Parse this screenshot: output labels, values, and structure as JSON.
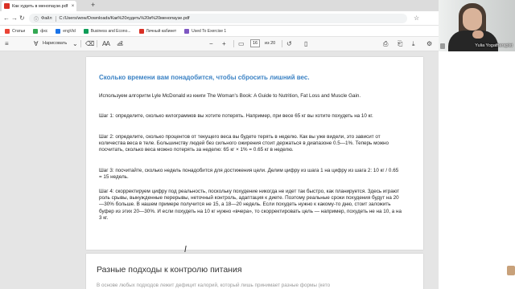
{
  "browser": {
    "tab": {
      "title": "Как худеть в менопаузе.pdf",
      "close": "×"
    },
    "new_tab": "+",
    "address": {
      "scheme_label": "Файл",
      "url": "C:/Users/wow/Downloads/Как%20худеть%20в%20менопаузе.pdf"
    },
    "bookmarks": [
      {
        "label": "Статьи",
        "color": "#ea4335"
      },
      {
        "label": "фхс",
        "color": "#34a853"
      },
      {
        "label": "engVid",
        "color": "#1a73e8"
      },
      {
        "label": "Business and Econo...",
        "color": "#0f9d58"
      },
      {
        "label": "Личный кабинет",
        "color": "#d93025"
      },
      {
        "label": "Used To Exercise 1",
        "color": "#7e57c2"
      }
    ]
  },
  "pdf_toolbar": {
    "draw_label": "Нарисовать",
    "page_current": "16",
    "page_total": "из 20",
    "zoom_out": "−",
    "zoom_in": "+"
  },
  "pdf": {
    "page1": {
      "heading": "Сколько времени вам понадобится, чтобы сбросить лишний вес.",
      "paragraphs": [
        "Используем алгоритм Lyle McDonald из книги The Woman's Book: A Guide to Nutrition, Fat Loss and Muscle Gain.",
        "Шаг 1: определите, сколько килограммов вы хотите потерять. Например, при весе 65 кг вы хотите похудеть на 10 кг.",
        "Шаг 2: определите, сколько процентов от текущего веса вы будете терять в неделю. Как вы уже видели, это зависит от количества веса в теле. Большинству людей без сильного ожирения стоит держаться в диапазоне 0.5—1%. Теперь можно посчитать, сколько веса можно потерять за неделю: 65 кг × 1% = 0.65 кг в неделю.",
        "Шаг 3: посчитайте, сколько недель понадобится для достижения цели. Делим цифру из шага 1 на цифру из шага 2: 10 кг / 0.65 = 15 недель.",
        "Шаг 4: скорректируем цифру под реальность, поскольку похудение никогда не идет так быстро, как планируется. Здесь играют роль срывы, вынужденные перерывы, неточный контроль, адаптация к диете. Поэтому реальные сроки похудения будут на 20—30% больше. В нашем примере получится не 15, а 18—20 недель. Если похудеть нужно к какому-то дню, стоит заложить буфер из этих 20—30%. И если похудеть на 10 кг нужно «вчера», то скорректировать цель — например, похудеть не на 10, а на 3 кг."
      ]
    },
    "page2": {
      "heading": "Разные подходы к контролю питания",
      "partial_text": "В основе любых подходов лежит дефицит калорий, который лишь принимает разные формы (кето"
    }
  },
  "webcam": {
    "name": "Yulia Yogatherapist"
  }
}
